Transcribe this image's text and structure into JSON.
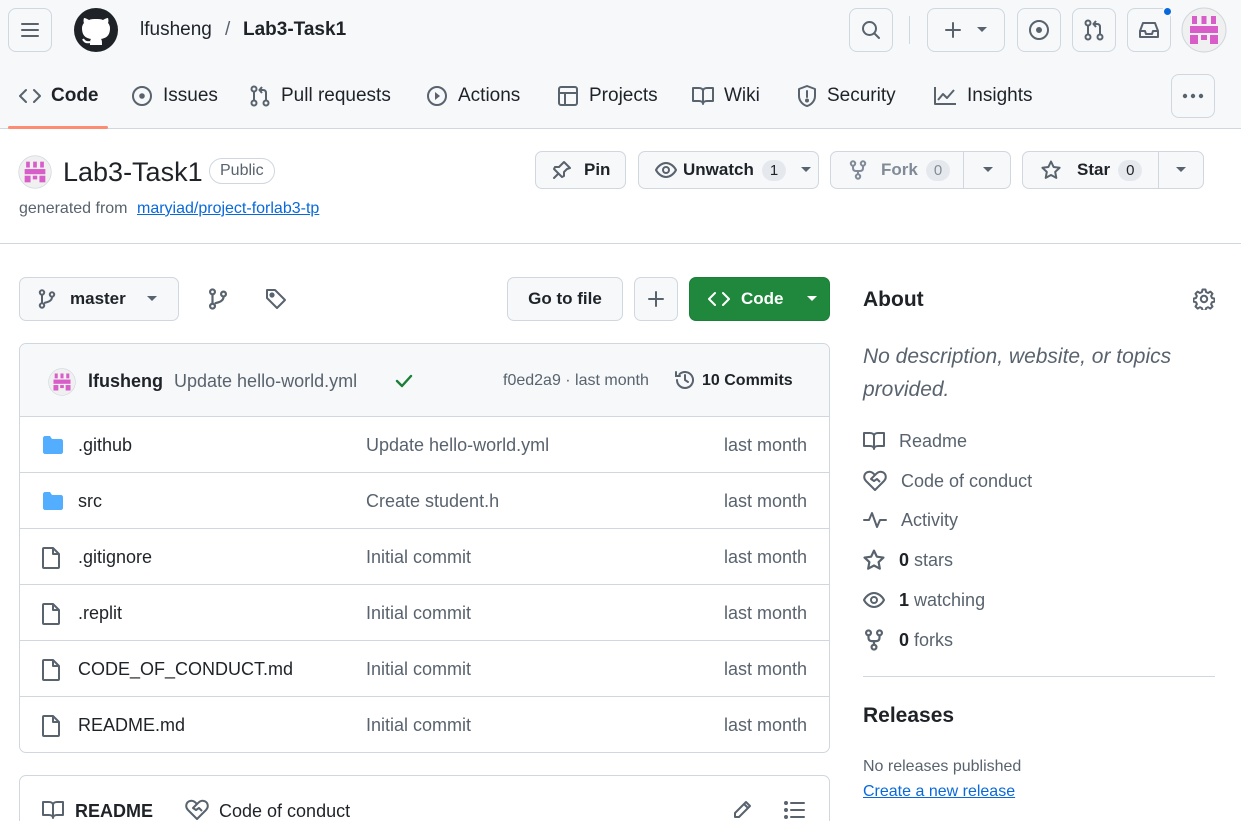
{
  "breadcrumb": {
    "owner": "lfusheng",
    "separator": "/",
    "repo": "Lab3-Task1"
  },
  "tabs": [
    {
      "label": "Code",
      "icon": "code-icon",
      "active": true
    },
    {
      "label": "Issues",
      "icon": "issue-icon"
    },
    {
      "label": "Pull requests",
      "icon": "pull-request-icon"
    },
    {
      "label": "Actions",
      "icon": "play-icon"
    },
    {
      "label": "Projects",
      "icon": "table-icon"
    },
    {
      "label": "Wiki",
      "icon": "book-icon"
    },
    {
      "label": "Security",
      "icon": "shield-icon"
    },
    {
      "label": "Insights",
      "icon": "graph-icon"
    }
  ],
  "repo": {
    "name": "Lab3-Task1",
    "visibility": "Public",
    "generated_prefix": "generated from",
    "generated_link": "maryiad/project-forlab3-tp"
  },
  "actions": {
    "pin": "Pin",
    "unwatch": "Unwatch",
    "watch_count": "1",
    "fork": "Fork",
    "fork_count": "0",
    "star": "Star",
    "star_count": "0"
  },
  "toolbar": {
    "branch": "master",
    "go_to_file": "Go to file",
    "code": "Code"
  },
  "commit": {
    "author": "lfusheng",
    "message": "Update hello-world.yml",
    "hash_time": "f0ed2a9 · last month",
    "commits": "10 Commits"
  },
  "files": [
    {
      "name": ".github",
      "type": "folder",
      "message": "Update hello-world.yml",
      "date": "last month"
    },
    {
      "name": "src",
      "type": "folder",
      "message": "Create student.h",
      "date": "last month"
    },
    {
      "name": ".gitignore",
      "type": "file",
      "message": "Initial commit",
      "date": "last month"
    },
    {
      "name": ".replit",
      "type": "file",
      "message": "Initial commit",
      "date": "last month"
    },
    {
      "name": "CODE_OF_CONDUCT.md",
      "type": "file",
      "message": "Initial commit",
      "date": "last month"
    },
    {
      "name": "README.md",
      "type": "file",
      "message": "Initial commit",
      "date": "last month"
    }
  ],
  "readme_tabs": {
    "readme": "README",
    "coc": "Code of conduct"
  },
  "about": {
    "title": "About",
    "description": "No description, website, or topics provided.",
    "readme": "Readme",
    "coc": "Code of conduct",
    "activity": "Activity",
    "stars_num": "0",
    "stars_label": "stars",
    "watching_num": "1",
    "watching_label": "watching",
    "forks_num": "0",
    "forks_label": "forks"
  },
  "releases": {
    "title": "Releases",
    "none": "No releases published",
    "create": "Create a new release"
  },
  "colors": {
    "primary_green": "#1f883d",
    "link_blue": "#0969da",
    "folder_blue": "#54aeff",
    "tab_underline": "#fd8c73",
    "avatar_pink": "#d85dc8",
    "notification_dot": "#0969da"
  }
}
